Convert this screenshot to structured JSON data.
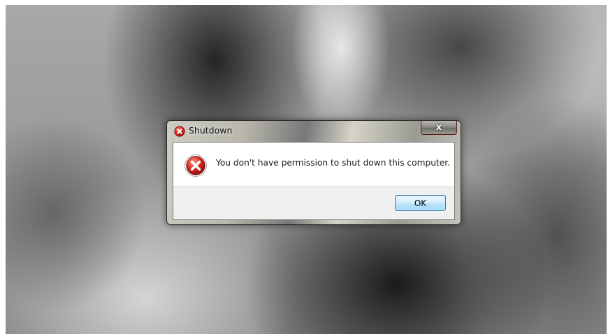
{
  "dialog": {
    "title": "Shutdown",
    "title_icon": "error-icon",
    "close_label": "x",
    "message": "You don't have permission to shut down this computer.",
    "message_icon": "error-icon",
    "ok_label": "OK"
  },
  "colors": {
    "error_red": "#d32020",
    "ok_button_border": "#3c7fb1",
    "button_area_bg": "#f0f0f0"
  }
}
